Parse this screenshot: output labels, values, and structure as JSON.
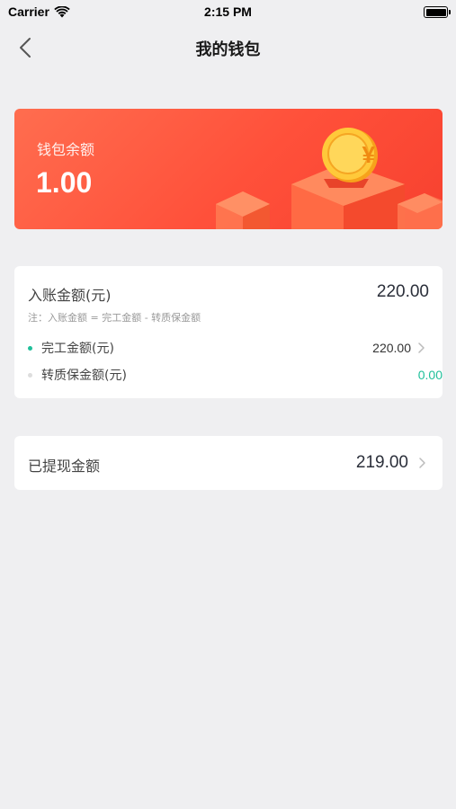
{
  "status_bar": {
    "carrier": "Carrier",
    "time": "2:15 PM"
  },
  "nav": {
    "title": "我的钱包",
    "back_icon": "chevron-left-icon"
  },
  "wallet": {
    "label": "钱包余额",
    "amount": "1.00",
    "coin_symbol": "¥"
  },
  "income": {
    "title": "入账金额(元)",
    "value": "220.00",
    "note": "注：入账金额 = 完工金额 - 转质保金额",
    "rows": [
      {
        "label": "完工金额(元)",
        "value": "220.00",
        "dot_color": "#1fbf9a",
        "value_color": "#333333"
      },
      {
        "label": "转质保金额(元)",
        "value": "0.00",
        "dot_color": "#dddddd",
        "value_color": "#1fbf9a"
      }
    ]
  },
  "withdrawn": {
    "label": "已提现金额",
    "value": "219.00"
  },
  "colors": {
    "accent_red": "#ff503a",
    "accent_green": "#1fbf9a",
    "background": "#efeff1"
  }
}
